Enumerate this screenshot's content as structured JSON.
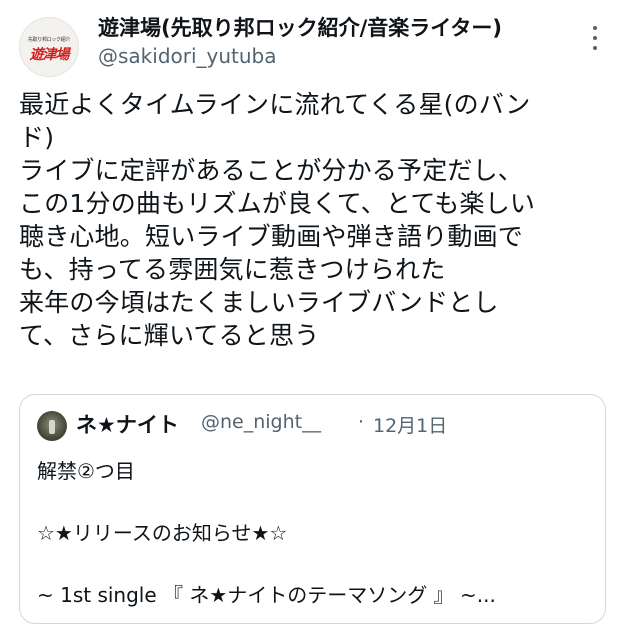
{
  "tweet": {
    "display_name": "遊津場(先取り邦ロック紹介/音楽ライター)",
    "handle": "@sakidori_yutuba",
    "avatar_text_small": "先取り邦ロック紹介",
    "avatar_text_big": "遊津場",
    "text_lines": [
      "最近よくタイムラインに流れてくる星(のバン",
      "ド)",
      "ライブに定評があることが分かる予定だし、",
      "この1分の曲もリズムが良くて、とても楽しい",
      "聴き心地。短いライブ動画や弾き語り動画で",
      "も、持ってる雰囲気に惹きつけられた",
      "来年の今頃はたくましいライブバンドとし",
      "て、さらに輝いてると思う"
    ]
  },
  "quote": {
    "name": "ネ★ナイト",
    "handle": "@ne_night__",
    "separator": "·",
    "date": "12月1日",
    "text_lines": [
      "解禁②つ目",
      "☆★リリースのお知らせ★☆",
      "~ 1st single 『 ネ★ナイトのテーマソング 』 ~..."
    ]
  },
  "colors": {
    "text_primary": "#0f1419",
    "text_secondary": "#536471",
    "border": "#cfd9de",
    "avatar_accent": "#d31f1f"
  },
  "icons": {
    "more": "more-vertical-icon"
  }
}
